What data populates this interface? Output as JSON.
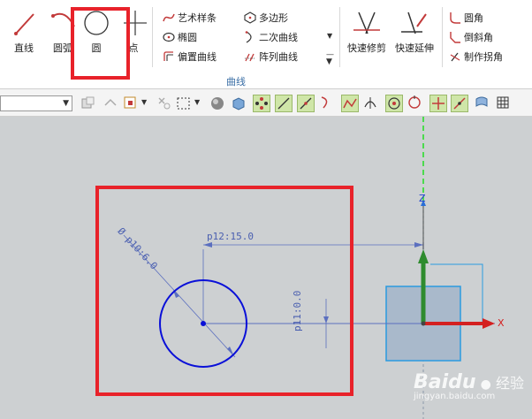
{
  "ribbon": {
    "large_buttons": {
      "line": "直线",
      "arc": "圆弧",
      "circle": "圆",
      "point": "点",
      "quick_trim": "快速修剪",
      "quick_extend": "快速延伸"
    },
    "curve_items": {
      "studio_spline": "艺术样条",
      "ellipse": "椭圆",
      "offset_curve": "偏置曲线",
      "polygon": "多边形",
      "conic": "二次曲线",
      "pattern_curve": "阵列曲线"
    },
    "corner_items": {
      "fillet": "圆角",
      "chamfer": "倒斜角",
      "make_corner": "制作拐角"
    },
    "group_label": "曲线"
  },
  "canvas": {
    "dimensions": {
      "diameter": "p10:6.0",
      "diameter_symbol": "Ø",
      "horizontal": "p12:15.0",
      "vertical": "p11:0.0"
    },
    "axes": {
      "z": "Z",
      "x": "X"
    },
    "watermark": {
      "brand": "Baidu",
      "brand_cn": "经验",
      "url": "jingyan.baidu.com"
    }
  },
  "colors": {
    "highlight": "#e8222a",
    "sketch": "#0a10d8",
    "dimension": "#5b6fbf",
    "canvas_bg": "#cdd0d2",
    "datum_fill": "#a9b9cb",
    "datum_border": "#2a9be0",
    "z_axis": "#2e8b2e",
    "x_axis": "#d42020"
  }
}
